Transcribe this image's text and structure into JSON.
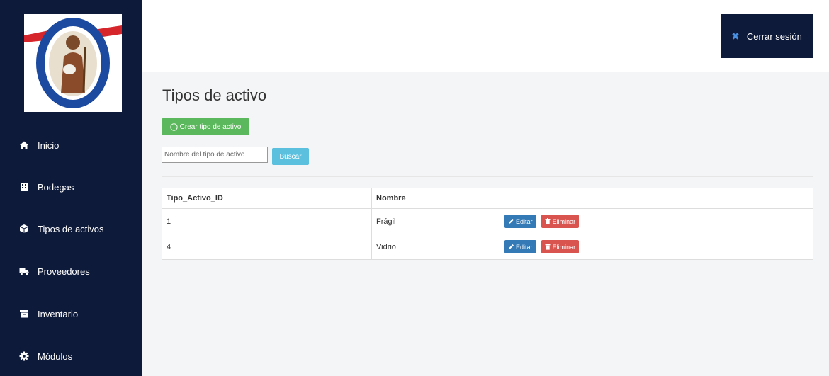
{
  "sidebar": {
    "logo": {
      "top_text": "PARROQUIA SAN JUAN BAUTISTA",
      "bottom_text": "TIBÁS, 1865"
    },
    "items": [
      {
        "label": "Inicio",
        "icon": "home-icon"
      },
      {
        "label": "Bodegas",
        "icon": "building-icon"
      },
      {
        "label": "Tipos de activos",
        "icon": "cube-icon"
      },
      {
        "label": "Proveedores",
        "icon": "truck-icon"
      },
      {
        "label": "Inventario",
        "icon": "archive-icon"
      },
      {
        "label": "Módulos",
        "icon": "gear-icon"
      }
    ]
  },
  "header": {
    "logout_label": "Cerrar sesión"
  },
  "main": {
    "title": "Tipos de activo",
    "create_label": "Crear tipo de activo",
    "search": {
      "placeholder": "Nombre del tipo de activo",
      "value": "",
      "button_label": "Buscar"
    },
    "table": {
      "columns": [
        "Tipo_Activo_ID",
        "Nombre",
        ""
      ],
      "rows": [
        {
          "id": "1",
          "nombre": "Frágil",
          "edit_label": "Editar",
          "delete_label": "Eliminar"
        },
        {
          "id": "4",
          "nombre": "Vidrio",
          "edit_label": "Editar",
          "delete_label": "Eliminar"
        }
      ]
    }
  },
  "colors": {
    "sidebar_bg": "#0e1a3a",
    "create_button": "#5cb85c",
    "search_button": "#5bc0de",
    "edit_button": "#337ab7",
    "delete_button": "#d9534f"
  }
}
